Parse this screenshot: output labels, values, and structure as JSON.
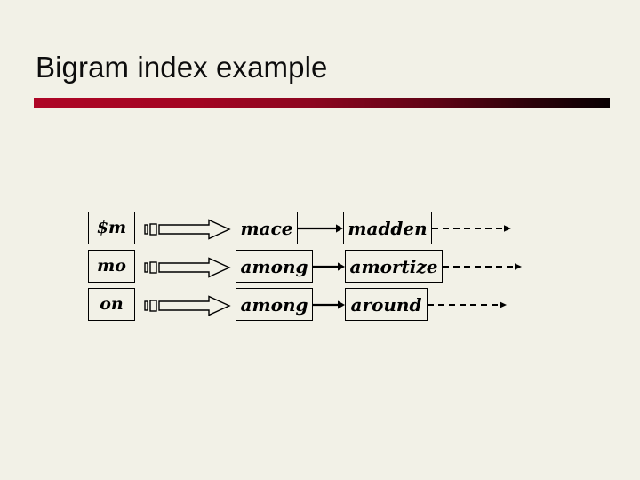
{
  "slide": {
    "title": "Bigram index example",
    "background_color": "#f2f1e7",
    "rule_color_start": "#ae0626",
    "rule_color_end": "#080002"
  },
  "diagram": {
    "type": "postings-lists",
    "rows": [
      {
        "key": "$m",
        "postings": [
          "mace",
          "madden"
        ],
        "has_trailing_dashed_arrow": true
      },
      {
        "key": "mo",
        "postings": [
          "among",
          "amortize"
        ],
        "has_trailing_dashed_arrow": true
      },
      {
        "key": "on",
        "postings": [
          "among",
          "around"
        ],
        "has_trailing_dashed_arrow": true
      }
    ]
  }
}
